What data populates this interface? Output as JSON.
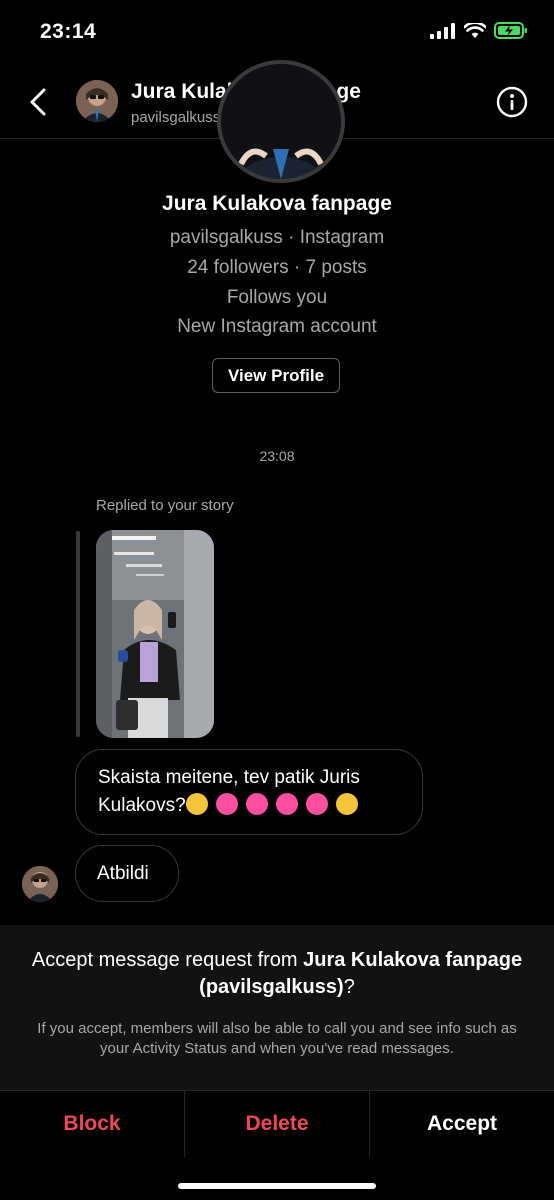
{
  "status_bar": {
    "time": "23:14"
  },
  "header": {
    "name": "Jura Kulakova fanpage",
    "username": "pavilsgalkuss"
  },
  "profile": {
    "name": "Jura Kulakova fanpage",
    "source": "pavilsgalkuss · Instagram",
    "stats": "24 followers · 7 posts",
    "follows": "Follows you",
    "account_note": "New Instagram account",
    "view_profile_label": "View Profile"
  },
  "thread": {
    "timestamp": "23:08",
    "replied_label": "Replied to your story",
    "messages": [
      {
        "text": "Skaista meitene, tev patik Juris Kulakovs?"
      },
      {
        "text": "Atbildi"
      }
    ]
  },
  "request": {
    "title_prefix": "Accept message request from ",
    "title_name": "Jura Kulakova fanpage (pavilsgalkuss)",
    "title_suffix": "?",
    "subtitle": "If you accept, members will also be able to call you and see info such as your Activity Status and when you've read messages."
  },
  "actions": {
    "block": "Block",
    "delete": "Delete",
    "accept": "Accept"
  },
  "colors": {
    "background": "#000000",
    "destructive": "#ed4956",
    "battery": "#4cd964",
    "secondary_text": "#a8a8a8"
  }
}
